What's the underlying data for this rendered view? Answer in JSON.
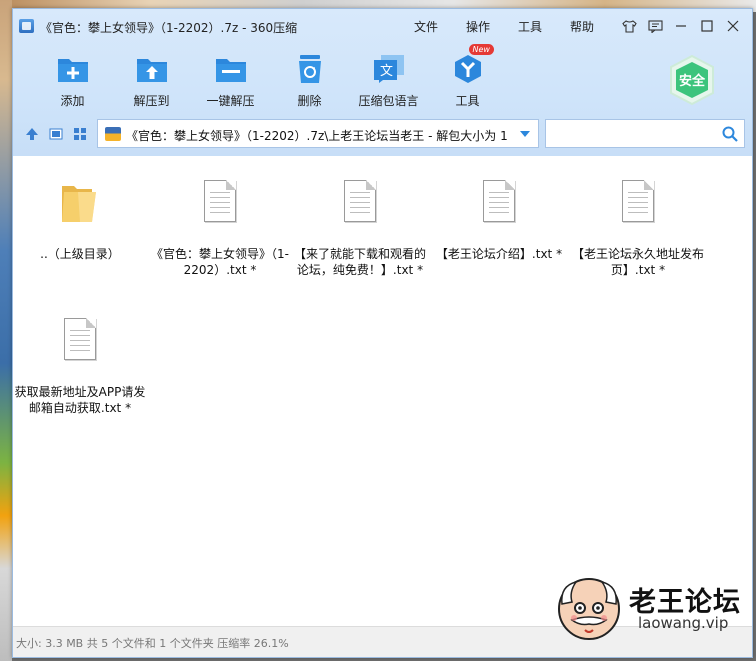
{
  "window": {
    "title": "《官色：攀上女领导》（1-2202）.7z - 360压缩",
    "menus": [
      "文件",
      "操作",
      "工具",
      "帮助"
    ]
  },
  "toolbar": {
    "items": [
      {
        "label": "添加",
        "icon": "add-icon"
      },
      {
        "label": "解压到",
        "icon": "extract-to-icon"
      },
      {
        "label": "一键解压",
        "icon": "one-click-extract-icon"
      },
      {
        "label": "删除",
        "icon": "delete-icon"
      },
      {
        "label": "压缩包语言",
        "icon": "language-icon"
      },
      {
        "label": "工具",
        "icon": "tools-icon",
        "badge": "New"
      }
    ],
    "safe_label": "安全"
  },
  "address": {
    "path": "《官色：攀上女领导》（1-2202）.7z\\上老王论坛当老王 - 解包大小为 1",
    "search_placeholder": ""
  },
  "files": [
    {
      "name": "..（上级目录）",
      "type": "folder"
    },
    {
      "name": "《官色：攀上女领导》（1-2202）.txt *",
      "type": "txt"
    },
    {
      "name": "【来了就能下载和观看的论坛，纯免费！】.txt *",
      "type": "txt"
    },
    {
      "name": "【老王论坛介绍】.txt *",
      "type": "txt"
    },
    {
      "name": "【老王论坛永久地址发布页】.txt *",
      "type": "txt"
    },
    {
      "name": "获取最新地址及APP请发邮箱自动获取.txt *",
      "type": "txt"
    }
  ],
  "status": {
    "text": "大小: 3.3 MB 共 5 个文件和 1 个文件夹 压缩率 26.1%"
  },
  "watermark": {
    "title": "老王论坛",
    "sub": "laowang.vip"
  },
  "colors": {
    "accent": "#2c87dc",
    "chrome_bg": "#d1e5fa",
    "safe_green": "#3cc47c"
  }
}
